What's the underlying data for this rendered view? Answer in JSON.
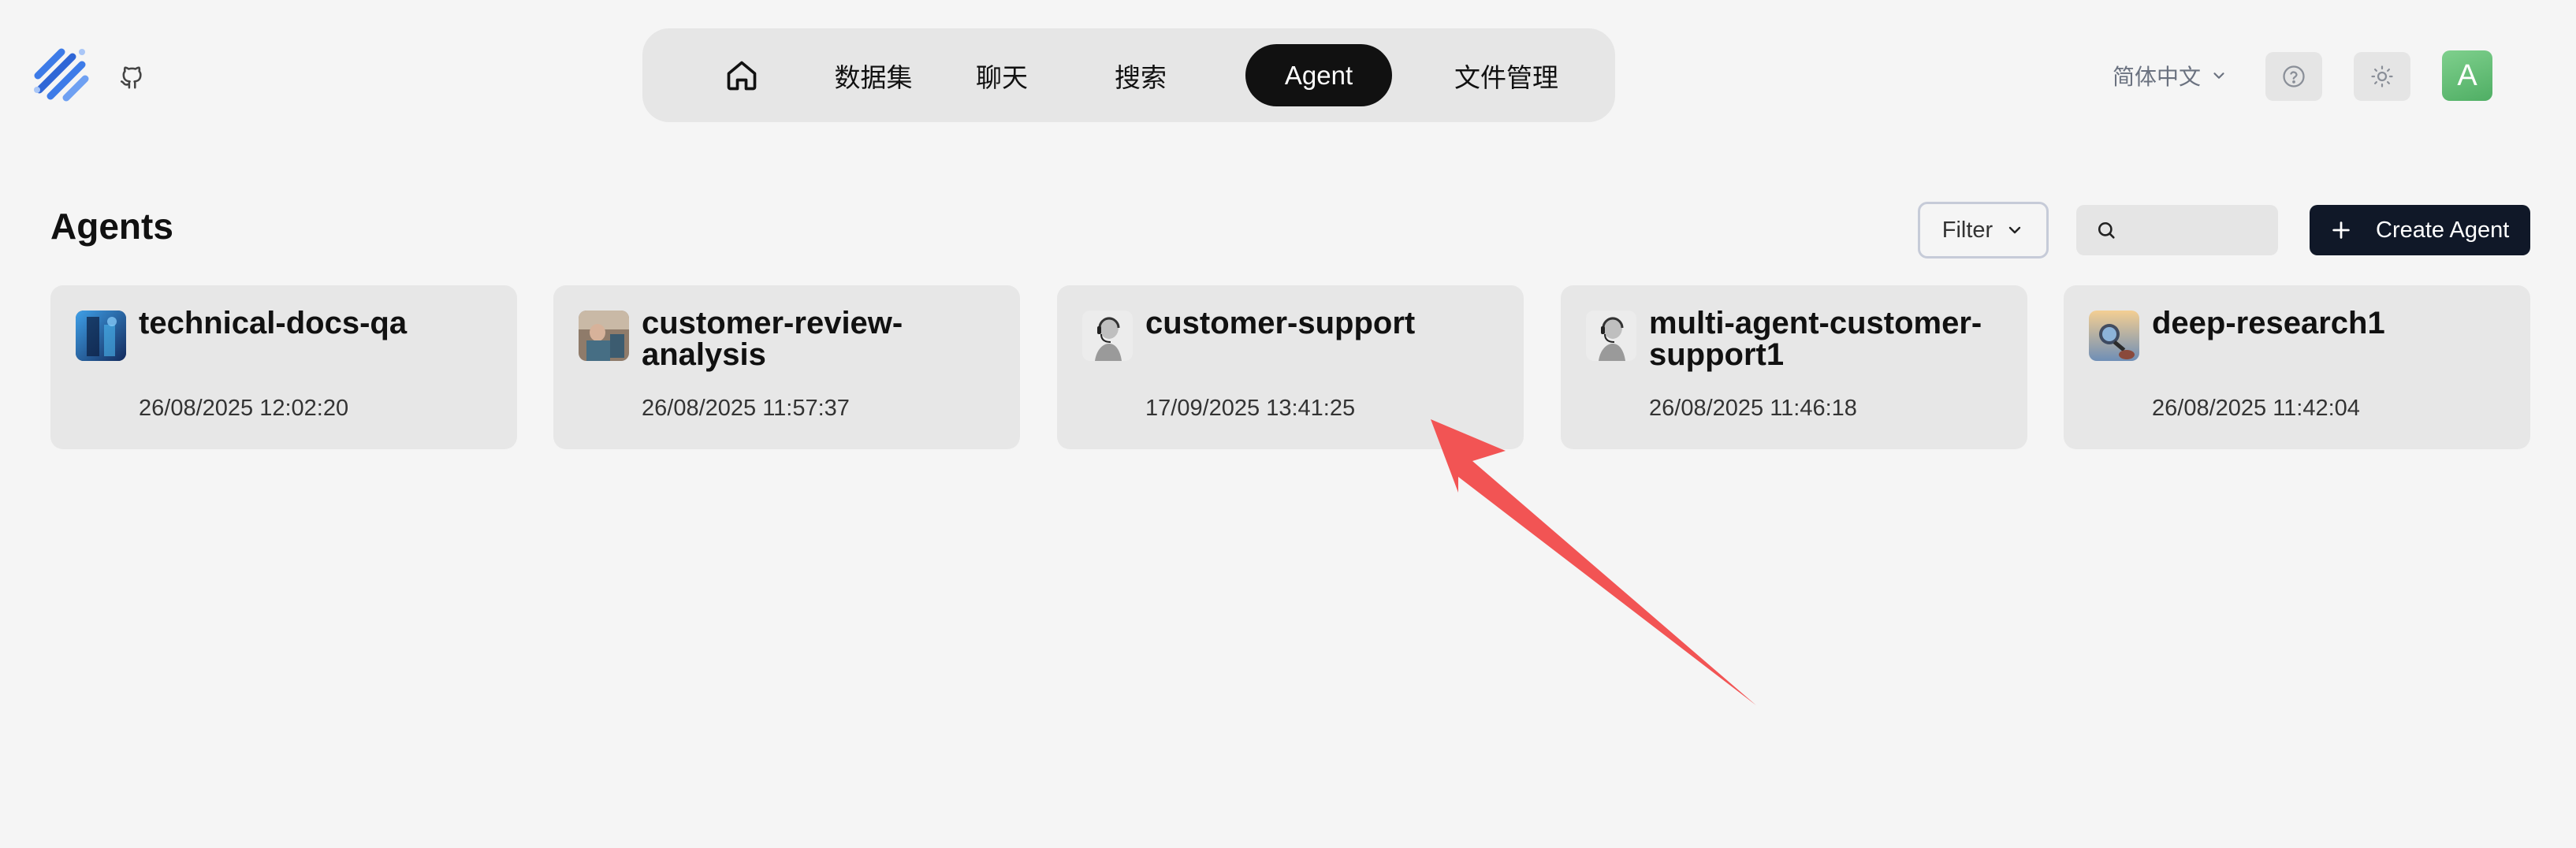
{
  "header": {
    "nav": [
      {
        "label": "",
        "icon": "home-icon"
      },
      {
        "label": "数据集"
      },
      {
        "label": "聊天"
      },
      {
        "label": "搜索"
      },
      {
        "label": "Agent",
        "active": true
      },
      {
        "label": "文件管理"
      }
    ],
    "language": "简体中文",
    "avatar_letter": "A"
  },
  "toolbar": {
    "title": "Agents",
    "filter_label": "Filter",
    "search_placeholder": "",
    "search_value": "",
    "create_label": "Create Agent"
  },
  "agents": [
    {
      "name": "technical-docs-qa",
      "date": "26/08/2025 12:02:20"
    },
    {
      "name": "customer-review-analysis",
      "date": "26/08/2025 11:57:37"
    },
    {
      "name": "customer-support",
      "date": "17/09/2025 13:41:25"
    },
    {
      "name": "multi-agent-customer-support1",
      "date": "26/08/2025 11:46:18"
    },
    {
      "name": "deep-research1",
      "date": "26/08/2025 11:42:04"
    }
  ],
  "colors": {
    "background": "#f5f5f5",
    "active_nav": "#111111",
    "create_button": "#101828",
    "avatar": "#5fbf72",
    "annotation_arrow": "#f25454"
  }
}
